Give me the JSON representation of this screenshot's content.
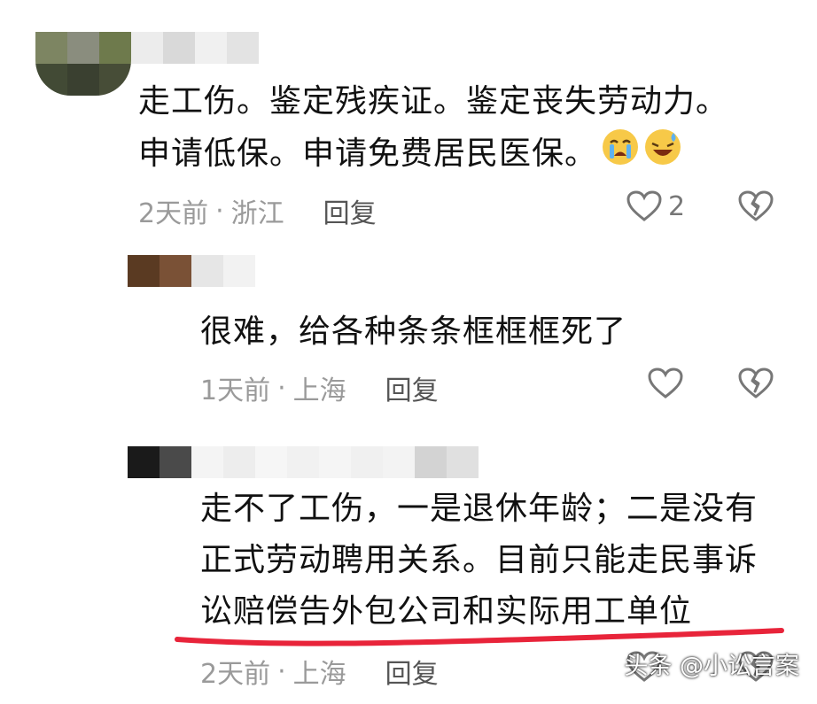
{
  "comments": [
    {
      "text_lines": [
        "走工伤。鉴定残疾证。鉴定丧失劳动力。",
        "申请低保。申请免费居民医保。"
      ],
      "emojis": [
        "crying-face-emoji",
        "grinning-sweat-face-emoji"
      ],
      "time": "2天前",
      "location": "浙江",
      "reply_label": "回复",
      "like_count": "2"
    },
    {
      "text_lines": [
        "很难，给各种条条框框框死了"
      ],
      "time": "1天前",
      "location": "上海",
      "reply_label": "回复"
    },
    {
      "text_lines": [
        "走不了工伤，一是退休年龄；二是没有",
        "正式劳动聘用关系。目前只能走民事诉",
        "讼赔偿告外包公司和实际用工单位"
      ],
      "time": "2天前",
      "location": "上海",
      "reply_label": "回复"
    }
  ],
  "separator": "·",
  "watermark": "头条 @小讼言案",
  "colors": {
    "underline": "#e8243a",
    "meta": "#9a9a9a",
    "text": "#111111"
  }
}
